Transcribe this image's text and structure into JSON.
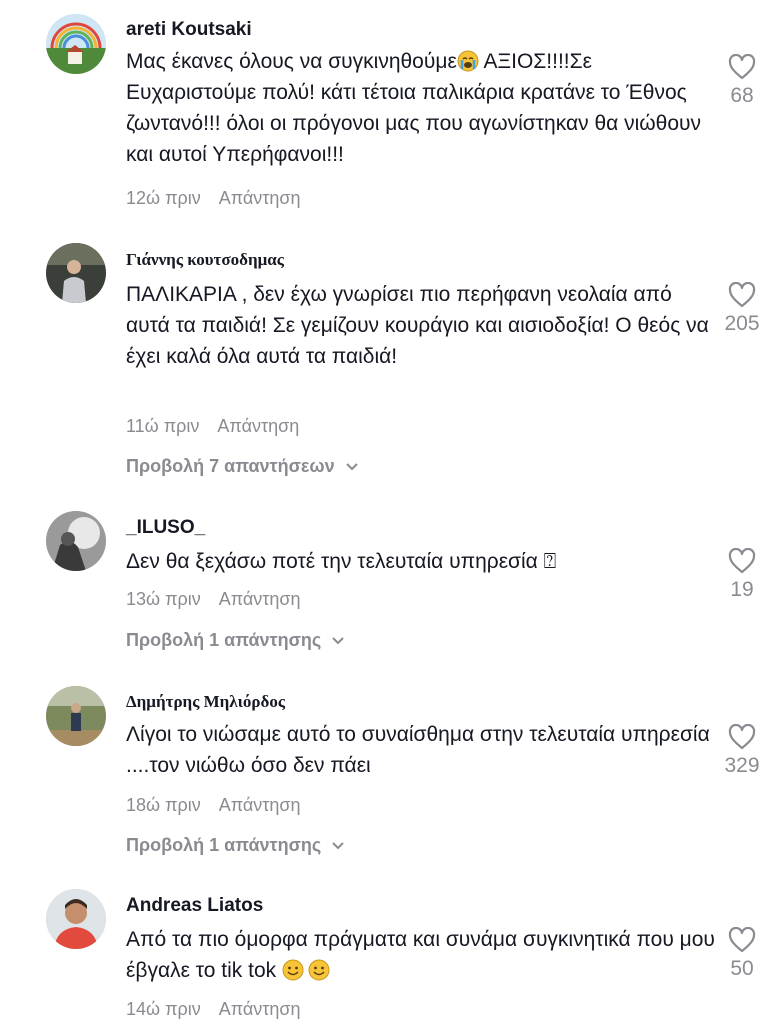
{
  "comments": [
    {
      "author": "areti Koutsaki",
      "text_before": "Μας έκανες όλους να συγκινηθούμε",
      "text_after": " ΑΞΙΟΣ!!!!Σε Ευχαριστούμε πολύ! κάτι τέτοια παλικάρια κρατάνε το Έθνος ζωντανό!!! όλοι οι πρόγονοι μας που αγωνίστηκαν θα νιώθουν και αυτοί Υπερήφανοι!!!",
      "time": "12ώ πριν",
      "reply": "Απάντηση",
      "likes": "68",
      "emoji": "crying-face-emoji"
    },
    {
      "author": "Γιάννης κουτσοδημας",
      "text": "ΠΑΛΙΚΑΡΙΑ , δεν έχω γνωρίσει πιο περήφανη νεολαία από αυτά τα παιδιά! Σε γεμίζουν κουράγιο και αισιοδοξία! Ο θεός να έχει καλά όλα αυτά τα παιδιά!",
      "time": "11ώ πριν",
      "reply": "Απάντηση",
      "likes": "205",
      "view_replies": "Προβολή 7 απαντήσεων"
    },
    {
      "author": "_ILUSO_",
      "text": "Δεν θα ξεχάσω ποτέ την τελευταία υπηρεσία ⍰",
      "time": "13ώ πριν",
      "reply": "Απάντηση",
      "likes": "19",
      "view_replies": "Προβολή 1 απάντησης"
    },
    {
      "author": "Δημήτρης Μηλιόρδος",
      "text": "Λίγοι το νιώσαμε αυτό το συναίσθημα στην τελευταία υπηρεσία ....τον νιώθω όσο δεν πάει",
      "time": "18ώ πριν",
      "reply": "Απάντηση",
      "likes": "329",
      "view_replies": "Προβολή 1 απάντησης"
    },
    {
      "author": "Andreas Liatos",
      "text": "Από τα πιο όμορφα πράγματα και συνάμα συγκινητικά που μου έβγαλε το tik tok ",
      "time": "14ώ πριν",
      "reply": "Απάντηση",
      "likes": "50",
      "emoji": "smiling-face-emoji"
    }
  ],
  "colors": {
    "text": "#161823",
    "muted": "#8a8b91",
    "background": "#ffffff"
  }
}
